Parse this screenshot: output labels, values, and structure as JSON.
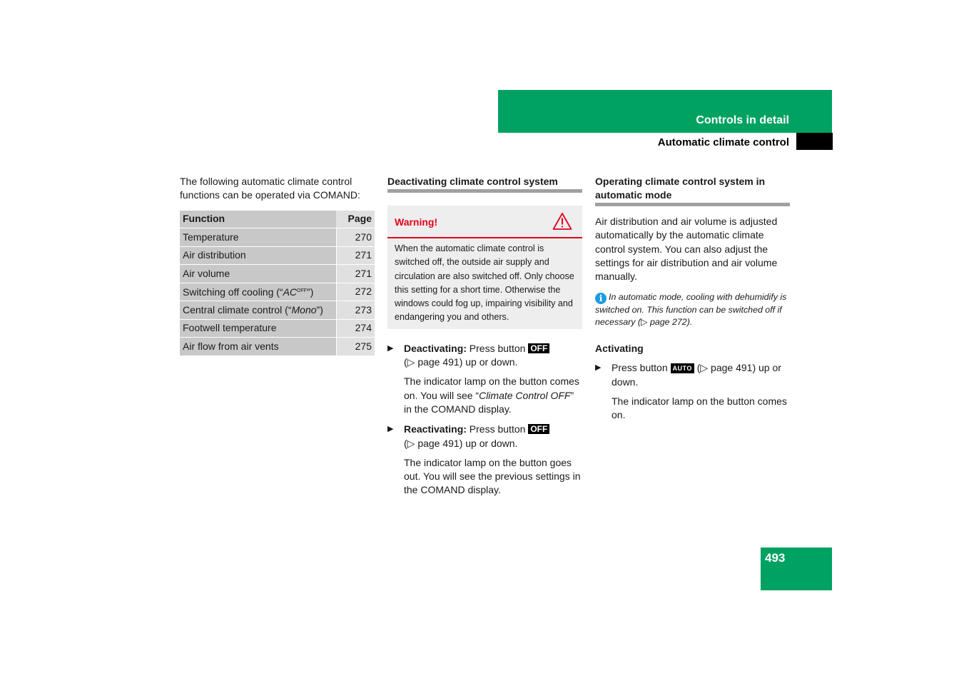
{
  "header": {
    "section": "Controls in detail",
    "subsection": "Automatic climate control"
  },
  "page_number": "493",
  "colors": {
    "brand_green": "#00a261",
    "warning_red": "#e2001a",
    "info_blue": "#1e9be0"
  },
  "column1": {
    "intro": "The following automatic climate control functions can be operated via COMAND:",
    "table": {
      "headers": [
        "Function",
        "Page"
      ],
      "rows": [
        {
          "function": "Temperature",
          "page": "270"
        },
        {
          "function": "Air distribution",
          "page": "271"
        },
        {
          "function": "Air volume",
          "page": "271"
        },
        {
          "function_prefix": "Switching off cooling (“",
          "function_italic": "AC",
          "function_sup": "OFF",
          "function_suffix": "”)",
          "page": "272"
        },
        {
          "function_prefix": "Central climate control (“",
          "function_italic": "Mono",
          "function_suffix": "”)",
          "page": "273"
        },
        {
          "function": "Footwell temperature",
          "page": "274"
        },
        {
          "function": "Air flow from air vents",
          "page": "275"
        }
      ]
    }
  },
  "column2": {
    "heading": "Deactivating climate control system",
    "warning": {
      "title": "Warning!",
      "icon": "warning-triangle-icon",
      "body": "When the automatic climate control is switched off, the outside air supply and circulation are also switched off. Only choose this setting for a short time. Otherwise the windows could fog up, impairing visibility and endangering you and others."
    },
    "steps": [
      {
        "label": "Deactivating:",
        "text": " Press button ",
        "button": "OFF",
        "ref": "(▷ page 491) up or down.",
        "result_prefix": "The indicator lamp on the button comes on. You will see “",
        "result_italic": "Climate Control OFF",
        "result_suffix": "” in the COMAND display."
      },
      {
        "label": "Reactivating:",
        "text": " Press button ",
        "button": "OFF",
        "ref": "(▷ page 491) up or down.",
        "result": "The indicator lamp on the button goes out. You will see the previous settings in the COMAND display."
      }
    ]
  },
  "column3": {
    "heading": "Operating climate control system in automatic mode",
    "intro": "Air distribution and air volume is adjusted automatically by the automatic climate control system. You can also adjust the settings for air distribution and air volume manually.",
    "note": {
      "icon": "info-icon",
      "text": "In automatic mode, cooling with dehumidify is switched on. This function can be switched off if necessary (▷ page 272)."
    },
    "subheading": "Activating",
    "step": {
      "text": "Press button ",
      "button": "AUTO",
      "ref": " (▷ page 491) up or down.",
      "result": "The indicator lamp on the button comes on."
    }
  },
  "bullet_glyph": "▶"
}
